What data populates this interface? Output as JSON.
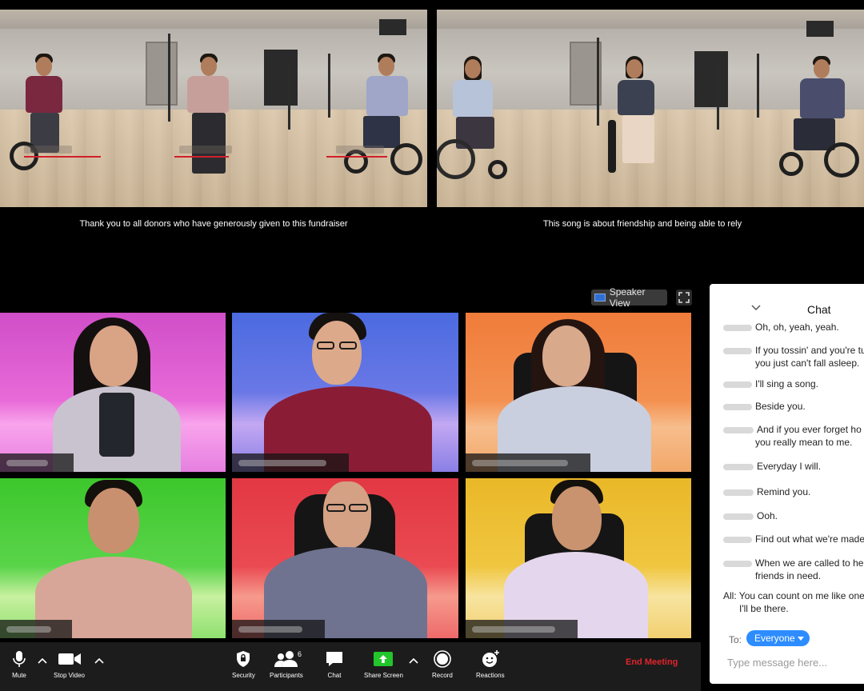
{
  "stage": {
    "left_caption": "Thank you to all donors who have generously given to this fundraiser",
    "right_caption": "This song is about friendship and being able to rely"
  },
  "view_controls": {
    "speaker_view_label": "Speaker View"
  },
  "toolbar": {
    "mute_label": "Mute",
    "stop_video_label": "Stop Video",
    "security_label": "Security",
    "participants_label": "Participants",
    "participants_count": "6",
    "chat_label": "Chat",
    "share_screen_label": "Share Screen",
    "record_label": "Record",
    "reactions_label": "Reactions",
    "end_meeting_label": "End Meeting"
  },
  "chat": {
    "title": "Chat",
    "messages": [
      {
        "line1": "Oh, oh, yeah, yeah.",
        "line2": ""
      },
      {
        "line1": "If you tossin' and you're tu",
        "line2": "you just can't fall asleep."
      },
      {
        "line1": "I'll sing a song.",
        "line2": ""
      },
      {
        "line1": "Beside you.",
        "line2": ""
      },
      {
        "line1": "And if you ever forget ho",
        "line2": "you really mean to me."
      },
      {
        "line1": "Everyday I will.",
        "line2": ""
      },
      {
        "line1": "Remind you.",
        "line2": ""
      },
      {
        "line1": "Ooh.",
        "line2": ""
      },
      {
        "line1": "Find out what we're made",
        "line2": ""
      },
      {
        "line1": "When we are called to he",
        "line2": "friends in need."
      },
      {
        "line1": "All: You can count on me like one",
        "line2": "I'll be there."
      }
    ],
    "to_label": "To:",
    "recipient": "Everyone",
    "input_placeholder": "Type message here..."
  },
  "colors": {
    "tile_1": "#e05fd0",
    "tile_2": "#6a6fe0",
    "tile_3": "#f08a4a",
    "tile_4": "#4cd13a",
    "tile_5": "#e8424a",
    "tile_6": "#f0c030",
    "share_green": "#22c52b",
    "end_red": "#e0242c",
    "chat_pill": "#2d8cff"
  },
  "icons": [
    "microphone-icon",
    "video-camera-icon",
    "shield-icon",
    "participants-icon",
    "chat-bubble-icon",
    "share-screen-icon",
    "record-icon",
    "reactions-icon",
    "fullscreen-icon",
    "chevron-down-icon"
  ]
}
